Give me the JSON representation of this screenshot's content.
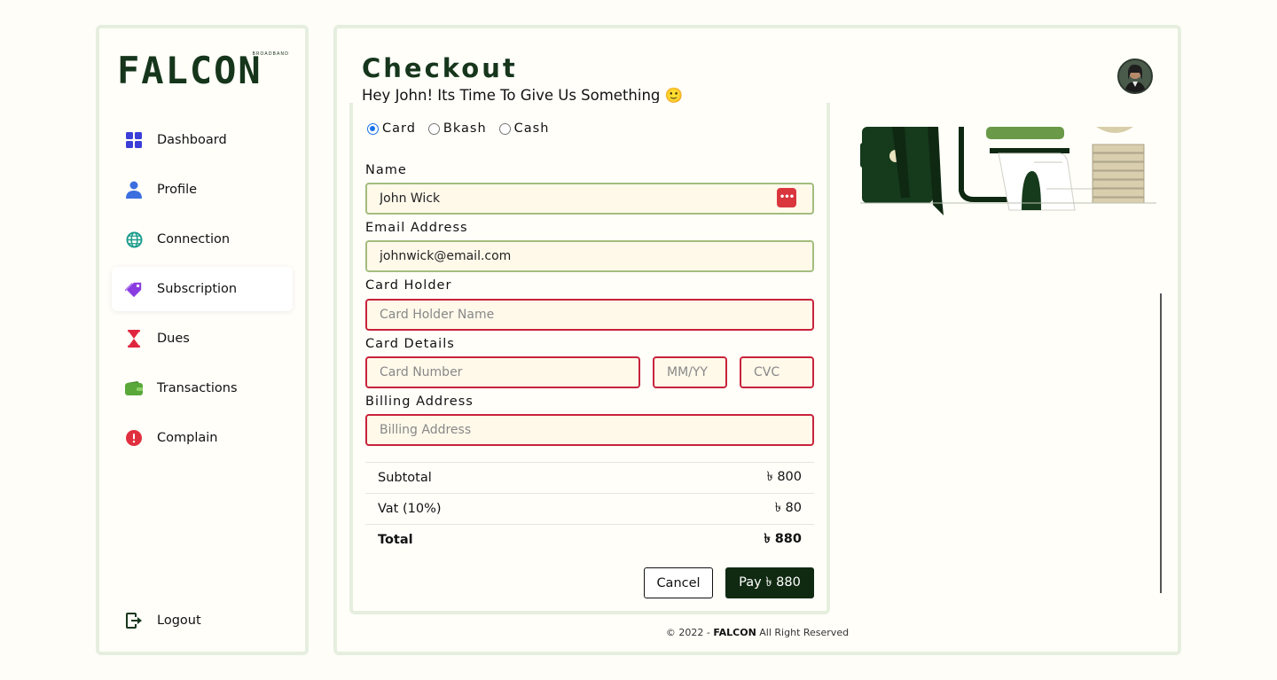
{
  "brand": {
    "logo_text": "FALCON",
    "logo_sub": "BROADBAND"
  },
  "sidebar": {
    "items": [
      {
        "label": "Dashboard",
        "icon": "dashboard-grid-icon",
        "color": "#3b3fd8"
      },
      {
        "label": "Profile",
        "icon": "person-icon",
        "color": "#3b6fe0"
      },
      {
        "label": "Connection",
        "icon": "globe-icon",
        "color": "#1a9c8c"
      },
      {
        "label": "Subscription",
        "icon": "tag-icon",
        "color": "#8a3ce0",
        "active": true
      },
      {
        "label": "Dues",
        "icon": "hourglass-icon",
        "color": "#e0263f"
      },
      {
        "label": "Transactions",
        "icon": "wallet-icon",
        "color": "#5aa83a"
      },
      {
        "label": "Complain",
        "icon": "alert-circle-icon",
        "color": "#e0303f"
      }
    ],
    "logout": {
      "label": "Logout",
      "icon": "logout-icon"
    }
  },
  "header": {
    "title": "Checkout",
    "subtitle": "Hey John! Its Time To Give Us Something 🙂"
  },
  "payment_methods": {
    "options": [
      "Card",
      "Bkash",
      "Cash"
    ],
    "selected": "Card"
  },
  "form": {
    "name": {
      "label": "Name",
      "value": "John Wick"
    },
    "email": {
      "label": "Email Address",
      "value": "johnwick@email.com"
    },
    "card_holder": {
      "label": "Card Holder",
      "placeholder": "Card Holder Name"
    },
    "card_details": {
      "label": "Card Details",
      "number_placeholder": "Card Number",
      "expiry_placeholder": "MM/YY",
      "cvc_placeholder": "CVC"
    },
    "billing": {
      "label": "Billing Address",
      "placeholder": "Billing Address"
    }
  },
  "summary": {
    "subtotal": {
      "label": "Subtotal",
      "value": "৳ 800"
    },
    "vat": {
      "label": "Vat (10%)",
      "value": "৳ 80"
    },
    "total": {
      "label": "Total",
      "value": "৳ 880"
    }
  },
  "buttons": {
    "cancel": "Cancel",
    "pay": "Pay ৳ 880"
  },
  "footer": {
    "prefix": "© 2022 - ",
    "brand": "FALCON",
    "suffix": " All Right Reserved"
  },
  "colors": {
    "brand_dark": "#16361c",
    "error": "#c8233b",
    "ok": "#a3bd7e",
    "input_bg": "#fff9ea"
  }
}
